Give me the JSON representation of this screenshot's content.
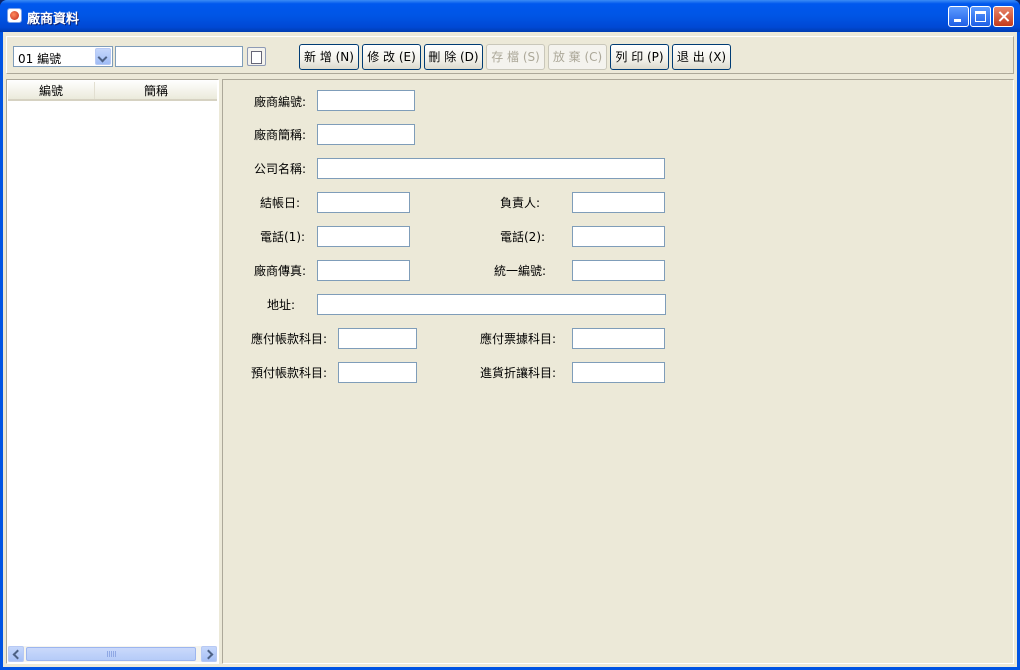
{
  "window": {
    "title": "廠商資料"
  },
  "toolbar": {
    "combo_value": "01 編號",
    "search_value": "",
    "buttons": {
      "add": "新 增 (N)",
      "edit": "修 改 (E)",
      "delete": "刪 除 (D)",
      "save": "存 檔 (S)",
      "discard": "放 棄 (C)",
      "print": "列 印 (P)",
      "exit": "退 出 (X)"
    }
  },
  "grid": {
    "columns": [
      "編號",
      "簡稱"
    ],
    "rows": []
  },
  "form": {
    "vendor_id_label": "廠商編號:",
    "vendor_short_label": "廠商簡稱:",
    "company_name_label": "公司名稱:",
    "closing_day_label": "結帳日:",
    "owner_label": "負責人:",
    "phone1_label": "電話(1):",
    "phone2_label": "電話(2):",
    "fax_label": "廠商傳真:",
    "tax_id_label": "統一編號:",
    "address_label": "地址:",
    "ap_account_label": "應付帳款科目:",
    "np_account_label": "應付票據科目:",
    "prepaid_account_label": "預付帳款科目:",
    "purchase_discount_label": "進貨折讓科目:"
  }
}
